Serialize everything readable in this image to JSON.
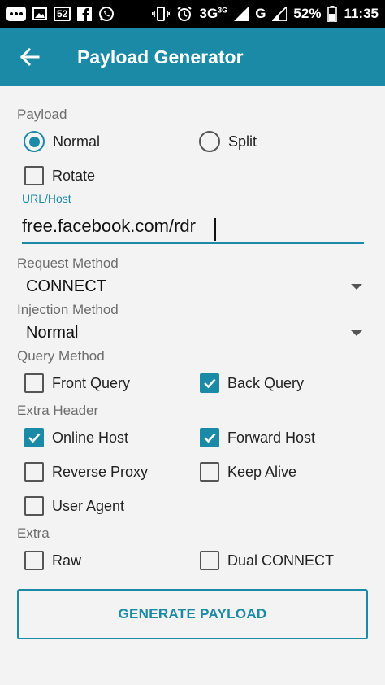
{
  "status_bar": {
    "sim_badge": "52",
    "network": "3G",
    "network_small": "3G",
    "network2": "G",
    "battery": "52%",
    "time": "11:35",
    "icons": [
      "menu-icon",
      "image-icon",
      "sim-icon",
      "facebook-icon",
      "whatsapp-icon",
      "vibrate-icon",
      "alarm-icon",
      "signal-icon",
      "signal-icon",
      "battery-icon"
    ]
  },
  "app_bar": {
    "title": "Payload Generator",
    "back_icon": "arrow-back-icon"
  },
  "form": {
    "payload": {
      "label": "Payload",
      "options": [
        {
          "label": "Normal",
          "selected": true
        },
        {
          "label": "Split",
          "selected": false
        }
      ],
      "rotate": {
        "label": "Rotate",
        "checked": false
      }
    },
    "url_host": {
      "label": "URL/Host",
      "value": "free.facebook.com/rdr"
    },
    "request_method": {
      "label": "Request Method",
      "value": "CONNECT"
    },
    "injection_method": {
      "label": "Injection Method",
      "value": "Normal"
    },
    "query_method": {
      "label": "Query Method",
      "options": [
        {
          "label": "Front Query",
          "checked": false
        },
        {
          "label": "Back Query",
          "checked": true
        }
      ]
    },
    "extra_header": {
      "label": "Extra Header",
      "options": [
        {
          "label": "Online Host",
          "checked": true
        },
        {
          "label": "Forward Host",
          "checked": true
        },
        {
          "label": "Reverse Proxy",
          "checked": false
        },
        {
          "label": "Keep Alive",
          "checked": false
        },
        {
          "label": "User Agent",
          "checked": false
        }
      ]
    },
    "extra": {
      "label": "Extra",
      "options": [
        {
          "label": "Raw",
          "checked": false
        },
        {
          "label": "Dual CONNECT",
          "checked": false
        }
      ]
    },
    "generate_button": "GENERATE PAYLOAD"
  },
  "colors": {
    "accent": "#1b8aa6",
    "status_bar": "#000000",
    "background": "#f3f3f3"
  }
}
